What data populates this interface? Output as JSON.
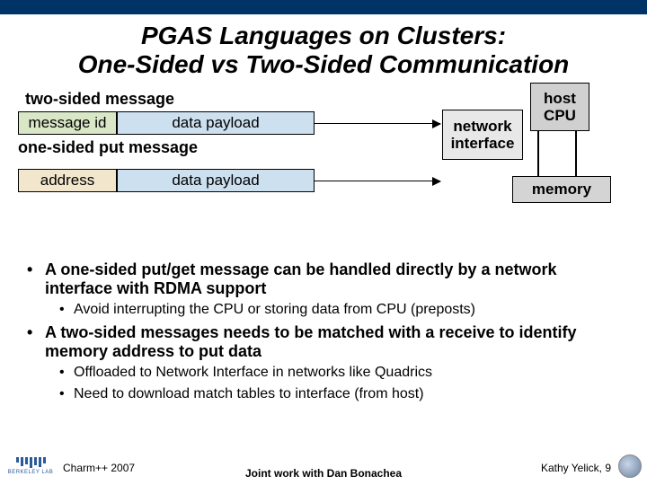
{
  "title_line1": "PGAS Languages on Clusters:",
  "title_line2": "One-Sided vs Two-Sided Communication",
  "diagram": {
    "two_sided_label": "two-sided message",
    "message_id": "message id",
    "data_payload": "data payload",
    "one_sided_label": "one-sided put message",
    "address": "address",
    "network_interface": "network\ninterface",
    "host_cpu": "host\nCPU",
    "memory": "memory"
  },
  "bullets": {
    "b1a": "A one-sided put/get message can be handled directly by a network interface with RDMA support",
    "b2a": "Avoid interrupting the CPU or storing data from CPU (preposts)",
    "b1b": "A two-sided messages needs to be matched with a receive to identify memory address to put data",
    "b2b": "Offloaded to Network Interface in networks like Quadrics",
    "b2c": "Need to download match tables to interface (from host)"
  },
  "footer": {
    "left": "Charm++ 2007",
    "center": "Joint work with Dan Bonachea",
    "right": "Kathy Yelick,  9"
  }
}
